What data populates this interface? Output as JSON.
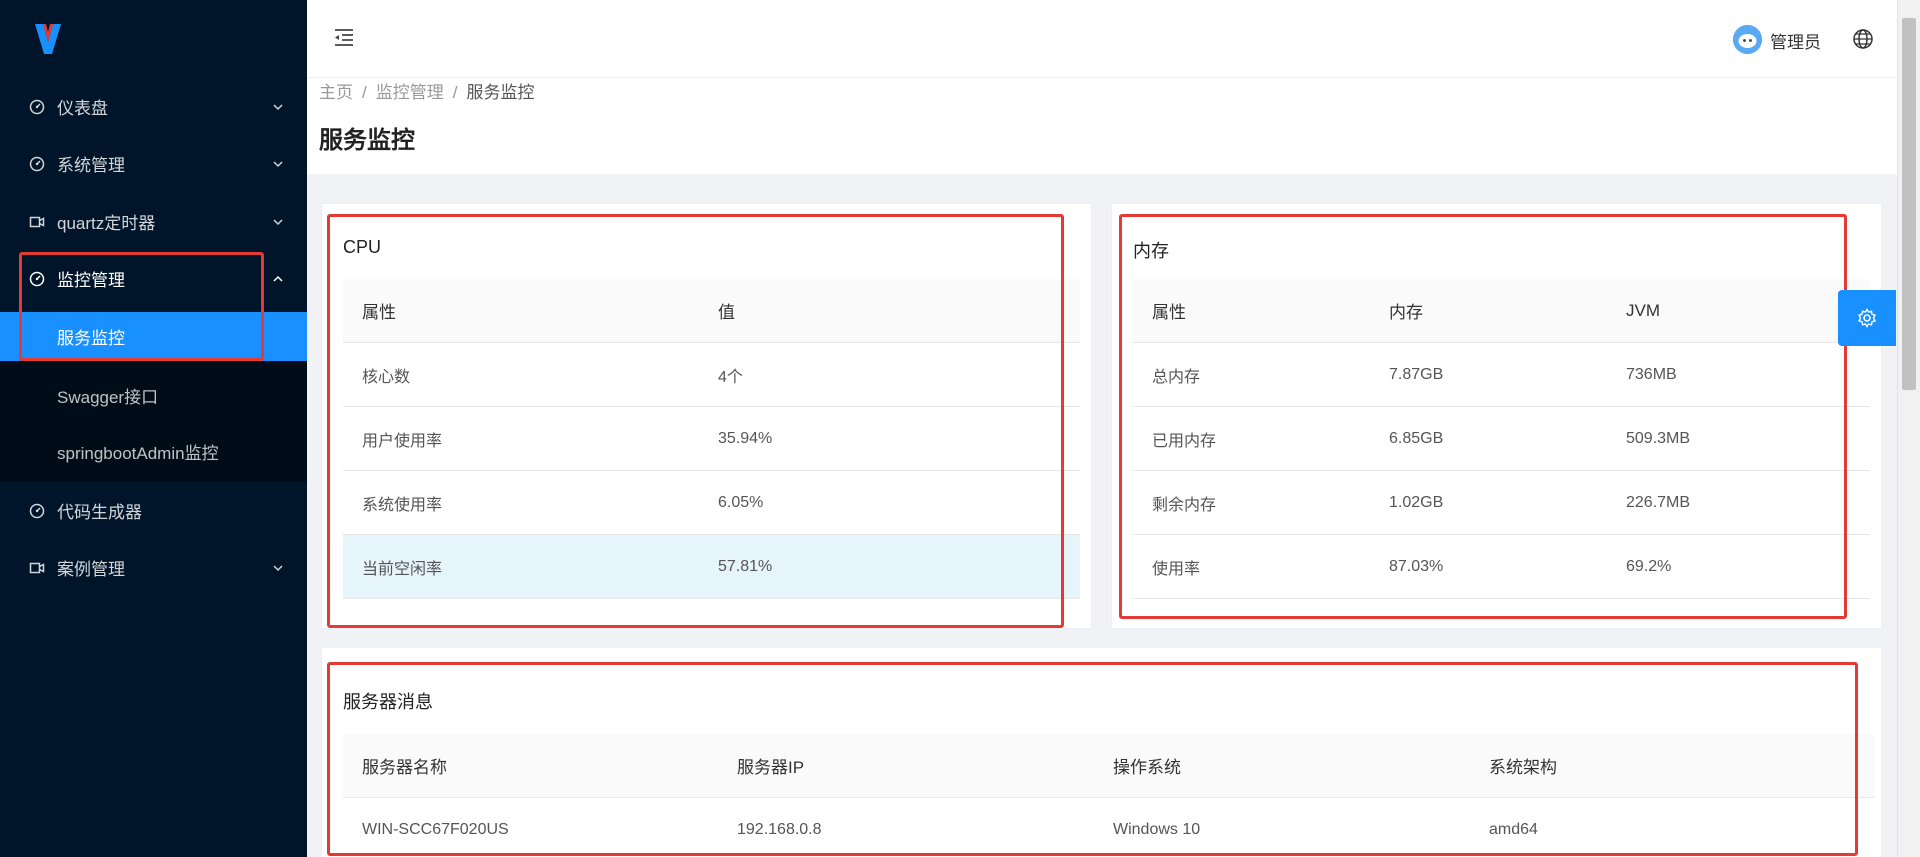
{
  "sidebar": {
    "logo": "vue-v-logo",
    "items": [
      {
        "label": "仪表盘",
        "icon": "dashboard-icon"
      },
      {
        "label": "系统管理",
        "icon": "dashboard-icon"
      },
      {
        "label": "quartz定时器",
        "icon": "video-camera-icon"
      },
      {
        "label": "监控管理",
        "icon": "dashboard-icon"
      },
      {
        "label": "代码生成器",
        "icon": "dashboard-icon"
      },
      {
        "label": "案例管理",
        "icon": "video-camera-icon"
      }
    ],
    "submenu": [
      {
        "label": "服务监控",
        "active": true
      },
      {
        "label": "Swagger接口",
        "active": false
      },
      {
        "label": "springbootAdmin监控",
        "active": false
      }
    ]
  },
  "header": {
    "user_name": "管理员"
  },
  "breadcrumb": {
    "home": "主页",
    "sep": "/",
    "parent": "监控管理",
    "current": "服务监控"
  },
  "page_title": "服务监控",
  "cpu": {
    "title": "CPU",
    "headers": [
      "属性",
      "值"
    ],
    "rows": [
      [
        "核心数",
        "4个"
      ],
      [
        "用户使用率",
        "35.94%"
      ],
      [
        "系统使用率",
        "6.05%"
      ],
      [
        "当前空闲率",
        "57.81%"
      ]
    ]
  },
  "memory": {
    "title": "内存",
    "headers": [
      "属性",
      "内存",
      "JVM"
    ],
    "rows": [
      [
        "总内存",
        "7.87GB",
        "736MB"
      ],
      [
        "已用内存",
        "6.85GB",
        "509.3MB"
      ],
      [
        "剩余内存",
        "1.02GB",
        "226.7MB"
      ],
      [
        "使用率",
        "87.03%",
        "69.2%"
      ]
    ]
  },
  "server": {
    "title": "服务器消息",
    "headers": [
      "服务器名称",
      "服务器IP",
      "操作系统",
      "系统架构"
    ],
    "rows": [
      [
        "WIN-SCC67F020US",
        "192.168.0.8",
        "Windows 10",
        "amd64"
      ]
    ]
  },
  "colors": {
    "sidebar_bg": "#001529",
    "submenu_bg": "#000c17",
    "accent": "#1890ff",
    "highlight_box": "#e53935"
  }
}
